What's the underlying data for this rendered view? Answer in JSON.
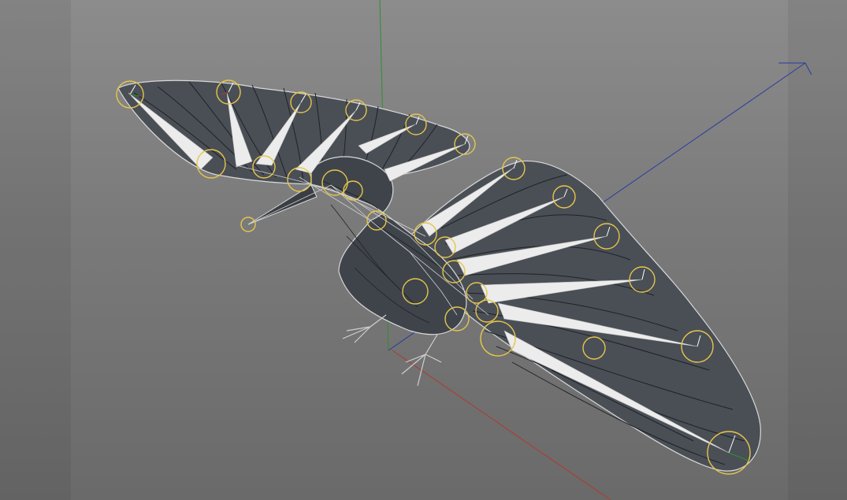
{
  "viewport": {
    "background_top": "#8c8c8c",
    "background_bottom": "#6a6a6a",
    "object": "bird-rig"
  },
  "axes_colors": {
    "x": "#b03a2e",
    "y": "#2f8f2f",
    "z": "#2a3aa0"
  },
  "colors": {
    "mesh": "#4a4f56",
    "mesh_edge": "#1f2226",
    "bone": "#ececec",
    "controller": "#e6c64a"
  }
}
